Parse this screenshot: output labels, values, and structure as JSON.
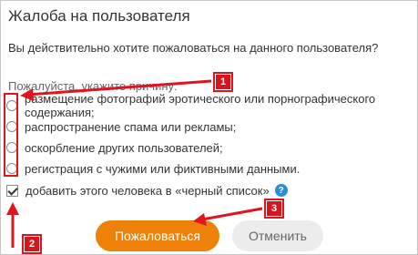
{
  "dialog": {
    "title": "Жалоба на пользователя",
    "question": "Вы действительно хотите пожаловаться на данного пользователя?",
    "prompt": "Пожалуйста, укажите причину:",
    "reasons": [
      "размещение фотографий эротического или порнографического содержания;",
      "распространение спама или рекламы;",
      "оскорбление других пользователей;",
      "регистрация с чужими или фиктивными данными."
    ],
    "blacklist_label": "добавить этого человека в «черный список»",
    "blacklist_checked": true,
    "help_glyph": "?",
    "submit_label": "Пожаловаться",
    "cancel_label": "Отменить"
  },
  "annotations": {
    "badge_1": "1",
    "badge_2": "2",
    "badge_3": "3",
    "color": "#e0141e"
  },
  "colors": {
    "accent": "#ee8208",
    "help": "#2a8dd8"
  }
}
